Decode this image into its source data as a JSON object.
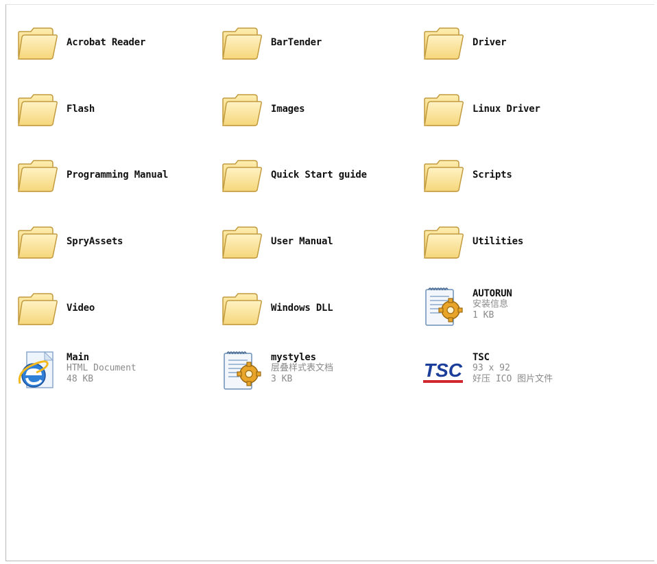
{
  "folders": [
    {
      "label": "Acrobat Reader"
    },
    {
      "label": "BarTender"
    },
    {
      "label": "Driver"
    },
    {
      "label": "Flash"
    },
    {
      "label": "Images"
    },
    {
      "label": "Linux Driver"
    },
    {
      "label": "Programming Manual"
    },
    {
      "label": "Quick Start guide"
    },
    {
      "label": "Scripts"
    },
    {
      "label": "SpryAssets"
    },
    {
      "label": "User Manual"
    },
    {
      "label": "Utilities"
    },
    {
      "label": "Video"
    },
    {
      "label": "Windows DLL"
    }
  ],
  "files": {
    "autorun": {
      "name": "AUTORUN",
      "type": "安装信息",
      "size": "1 KB",
      "icon": "setup-info-icon"
    },
    "main": {
      "name": "Main",
      "type": "HTML Document",
      "size": "48 KB",
      "icon": "internet-explorer-icon"
    },
    "mystyles": {
      "name": "mystyles",
      "type": "层叠样式表文档",
      "size": "3 KB",
      "icon": "stylesheet-icon"
    },
    "tsc": {
      "name": "TSC",
      "dimensions": "93 x 92",
      "type": "好压 ICO 图片文件",
      "icon": "tsc-logo-icon",
      "logo_text": "TSC"
    }
  },
  "colors": {
    "folder_fill": "#fbe49a",
    "folder_stroke": "#c8a44a",
    "tsc_blue": "#1b3e9a",
    "tsc_red": "#d0282e"
  }
}
